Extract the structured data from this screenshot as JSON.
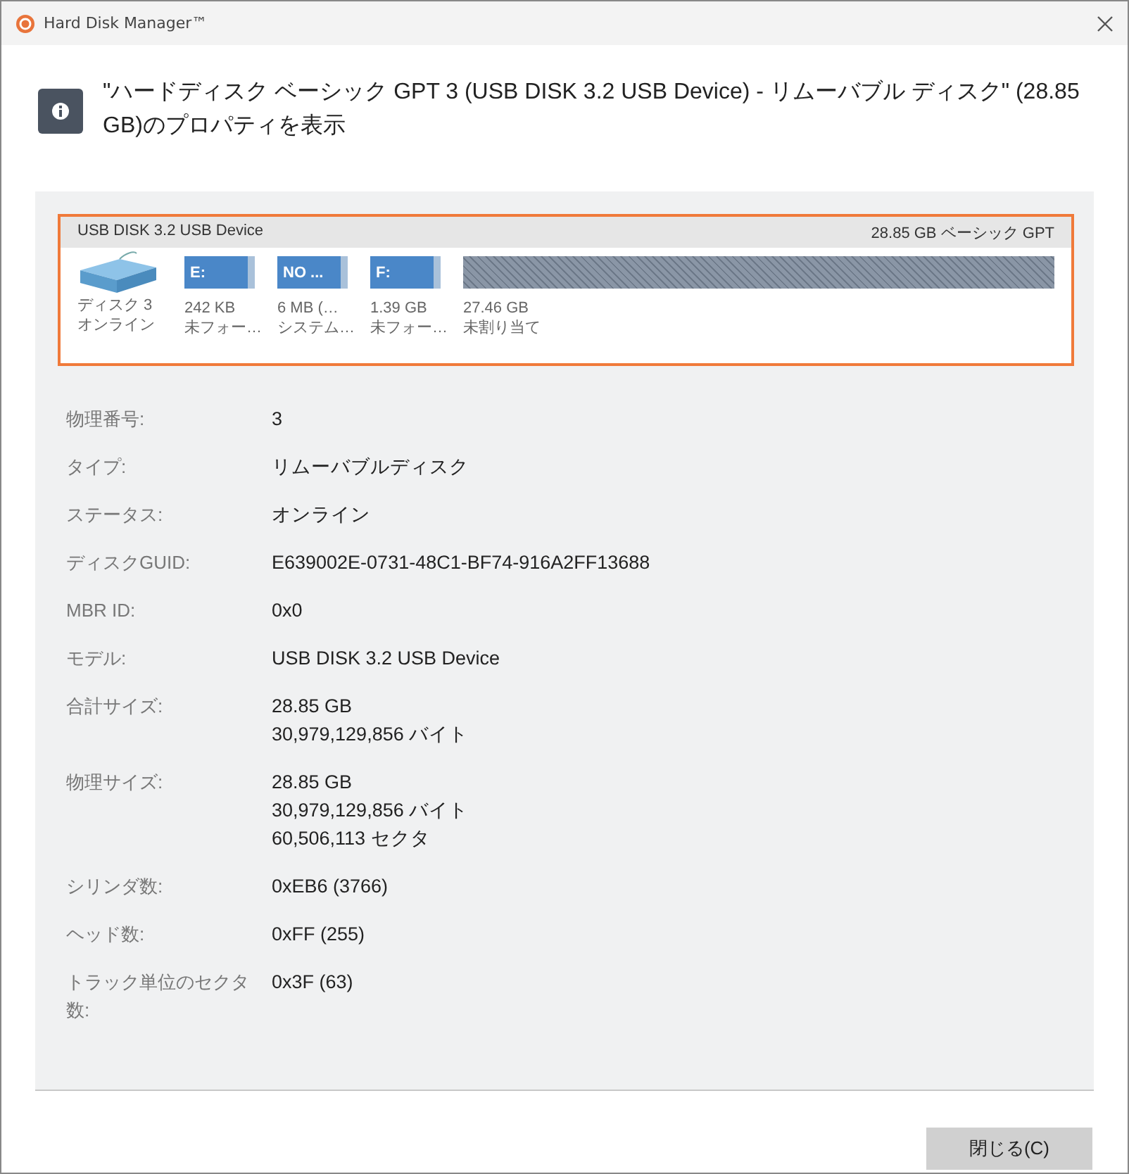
{
  "window": {
    "title": "Hard Disk Manager™"
  },
  "heading": "\"ハードディスク ベーシック GPT 3 (USB DISK 3.2 USB Device) - リムーバブル ディスク\" (28.85 GB)のプロパティを表示",
  "disk_map": {
    "name": "USB DISK 3.2 USB Device",
    "summary": "28.85 GB ベーシック GPT",
    "disk_label": "ディスク 3",
    "disk_status": "オンライン",
    "partitions": [
      {
        "kind": "partition",
        "label": "E:",
        "size": "242 KB",
        "fs": "未フォー…"
      },
      {
        "kind": "partition",
        "label": "NO ...",
        "size": "6 MB (…",
        "fs": "システム…"
      },
      {
        "kind": "partition",
        "label": "F:",
        "size": "1.39 GB",
        "fs": "未フォー…"
      },
      {
        "kind": "unallocated",
        "size": "27.46 GB",
        "fs": "未割り当て"
      }
    ]
  },
  "properties": [
    {
      "label": "物理番号:",
      "lines": [
        "3"
      ]
    },
    {
      "label": "タイプ:",
      "lines": [
        "リムーバブルディスク"
      ]
    },
    {
      "label": "ステータス:",
      "lines": [
        "オンライン"
      ]
    },
    {
      "label": "ディスクGUID:",
      "lines": [
        "E639002E-0731-48C1-BF74-916A2FF13688"
      ]
    },
    {
      "label": "MBR ID:",
      "lines": [
        "0x0"
      ]
    },
    {
      "label": "モデル:",
      "lines": [
        "USB DISK 3.2 USB Device"
      ]
    },
    {
      "label": "合計サイズ:",
      "lines": [
        "28.85 GB",
        "30,979,129,856 バイト"
      ]
    },
    {
      "label": "物理サイズ:",
      "lines": [
        "28.85 GB",
        "30,979,129,856 バイト",
        "60,506,113 セクタ"
      ]
    },
    {
      "label": "シリンダ数:",
      "lines": [
        "0xEB6 (3766)"
      ]
    },
    {
      "label": "ヘッド数:",
      "lines": [
        "0xFF (255)"
      ]
    },
    {
      "label": "トラック単位のセクタ数:",
      "lines": [
        "0x3F (63)"
      ]
    }
  ],
  "buttons": [
    "閉じる(C)"
  ]
}
